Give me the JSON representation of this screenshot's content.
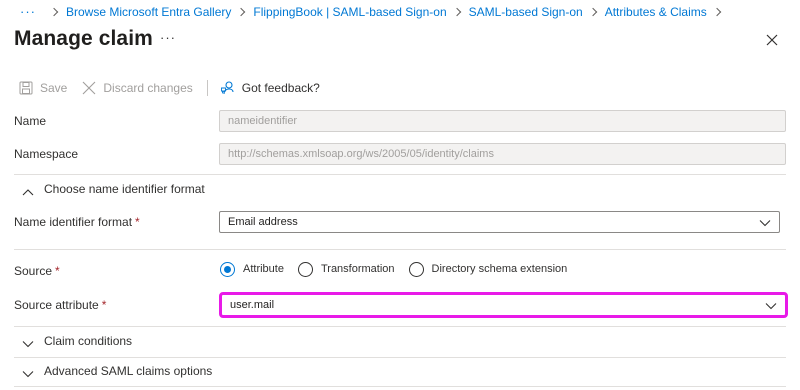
{
  "breadcrumb": {
    "more": "···",
    "items": [
      "Browse Microsoft Entra Gallery",
      "FlippingBook | SAML-based Sign-on",
      "SAML-based Sign-on",
      "Attributes & Claims"
    ]
  },
  "page": {
    "title": "Manage claim",
    "more": "···"
  },
  "toolbar": {
    "save_label": "Save",
    "discard_label": "Discard changes",
    "feedback_label": "Got feedback?"
  },
  "form": {
    "name": {
      "label": "Name",
      "value": "nameidentifier"
    },
    "namespace": {
      "label": "Namespace",
      "value": "http://schemas.xmlsoap.org/ws/2005/05/identity/claims"
    },
    "name_id_section": {
      "label": "Choose name identifier format"
    },
    "name_id_format": {
      "label": "Name identifier format",
      "required": "*",
      "value": "Email address"
    },
    "source": {
      "label": "Source",
      "required": "*",
      "options": [
        "Attribute",
        "Transformation",
        "Directory schema extension"
      ],
      "selected": "Attribute"
    },
    "source_attribute": {
      "label": "Source attribute",
      "required": "*",
      "value": "user.mail"
    },
    "claim_conditions": {
      "label": "Claim conditions"
    },
    "advanced_options": {
      "label": "Advanced SAML claims options"
    }
  },
  "colors": {
    "link": "#0078d4",
    "required": "#a4262c",
    "focus_highlight": "#e81ae8"
  }
}
